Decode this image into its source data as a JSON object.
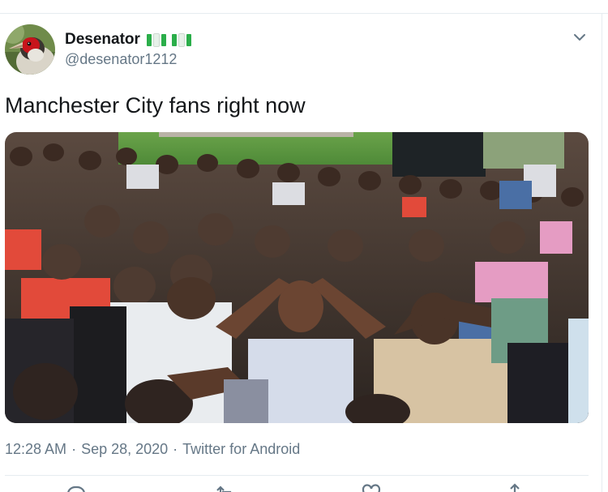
{
  "author": {
    "display_name": "Desenator",
    "handle": "@desenator1212",
    "avatar_icon": "bird-avatar-icon",
    "name_emoji": "nigeria-flag-icon",
    "flag_colors": [
      "#008751",
      "#ffffff",
      "#008751"
    ]
  },
  "menu": {
    "icon": "chevron-down-icon"
  },
  "tweet": {
    "text": "Manchester City fans right now",
    "media": {
      "type": "photo",
      "description_icon": "photo"
    }
  },
  "meta": {
    "time": "12:28 AM",
    "separator_1": "·",
    "date": "Sep 28, 2020",
    "separator_2": "·",
    "source": "Twitter for Android"
  },
  "actions": {
    "icons": [
      "reply-icon",
      "retweet-icon",
      "like-icon",
      "share-icon"
    ]
  },
  "colors": {
    "text_primary": "#14171a",
    "text_secondary": "#657786",
    "divider": "#e6ecf0"
  }
}
